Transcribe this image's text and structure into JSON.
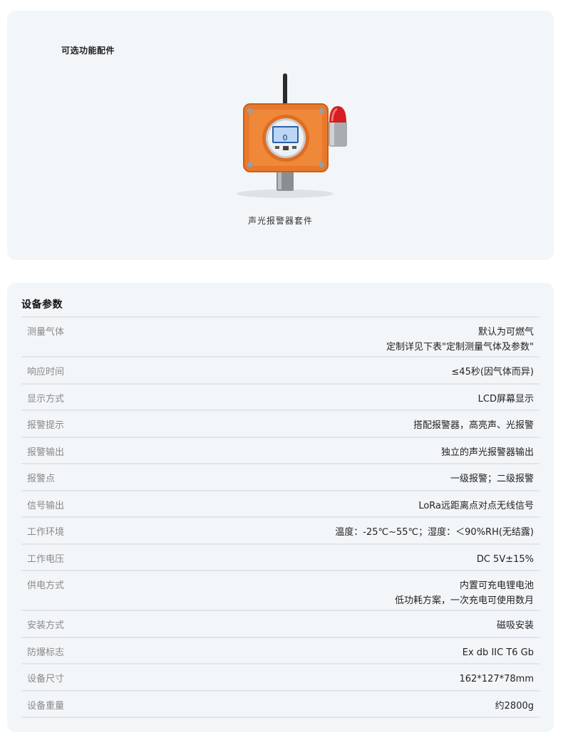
{
  "accessories": {
    "title": "可选功能配件",
    "items": [
      {
        "caption": "声光报警器套件",
        "device_screen_value": "0"
      }
    ]
  },
  "params": {
    "title": "设备参数",
    "rows": [
      {
        "label": "测量气体",
        "values": [
          "默认为可燃气",
          "定制详见下表\"定制测量气体及参数\""
        ]
      },
      {
        "label": "响应时间",
        "values": [
          "≤45秒(因气体而异)"
        ]
      },
      {
        "label": "显示方式",
        "values": [
          "LCD屏幕显示"
        ]
      },
      {
        "label": "报警提示",
        "values": [
          "搭配报警器，高亮声、光报警"
        ]
      },
      {
        "label": "报警输出",
        "values": [
          "独立的声光报警器输出"
        ]
      },
      {
        "label": "报警点",
        "values": [
          "一级报警；二级报警"
        ]
      },
      {
        "label": "信号输出",
        "values": [
          "LoRa远距离点对点无线信号"
        ]
      },
      {
        "label": "工作环境",
        "values": [
          "温度：-25℃~55℃；湿度：＜90%RH(无结露)"
        ]
      },
      {
        "label": "工作电压",
        "values": [
          "DC 5V±15%"
        ]
      },
      {
        "label": "供电方式",
        "values": [
          "内置可充电锂电池",
          "低功耗方案，一次充电可使用数月"
        ]
      },
      {
        "label": "安装方式",
        "values": [
          "磁吸安装"
        ]
      },
      {
        "label": "防爆标志",
        "values": [
          "Ex db IIC T6 Gb"
        ]
      },
      {
        "label": "设备尺寸",
        "values": [
          "162*127*78mm"
        ]
      },
      {
        "label": "设备重量",
        "values": [
          "约2800g"
        ]
      }
    ]
  }
}
